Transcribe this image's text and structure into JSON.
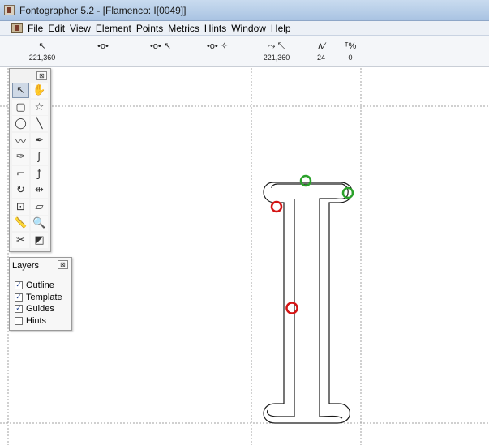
{
  "window": {
    "title": "Fontographer 5.2 - [Flamenco: I[0049]]",
    "app_icon": "fontographer-app-icon"
  },
  "menu": {
    "doc_icon": "document-icon",
    "items": [
      "File",
      "Edit",
      "View",
      "Element",
      "Points",
      "Metrics",
      "Hints",
      "Window",
      "Help"
    ]
  },
  "infobar": {
    "cells": [
      {
        "icon": "arrow-cursor-icon",
        "glyph": "↖",
        "value": "221,360"
      },
      {
        "icon": "curve-point-icon",
        "glyph": "•o•",
        "value": ""
      },
      {
        "icon": "point-arrow-icon",
        "glyph": "•o• ↖",
        "value": ""
      },
      {
        "icon": "point-star-icon",
        "glyph": "•o• ✧",
        "value": ""
      },
      {
        "icon": "move-arrow-icon",
        "glyph": "⤳ ↖",
        "value": "221,360"
      },
      {
        "icon": "angle-icon",
        "glyph": "∧∕",
        "value": "24"
      },
      {
        "icon": "percent-icon",
        "glyph": "ᵀ%",
        "value": "0"
      }
    ]
  },
  "tool_palette": {
    "close_label": "⊠",
    "tools": [
      {
        "name": "pointer-tool-icon",
        "glyph": "↖",
        "selected": true
      },
      {
        "name": "hand-tool-icon",
        "glyph": "✋",
        "selected": false
      },
      {
        "name": "rectangle-tool-icon",
        "glyph": "▢",
        "selected": false
      },
      {
        "name": "star-tool-icon",
        "glyph": "☆",
        "selected": false
      },
      {
        "name": "ellipse-tool-icon",
        "glyph": "◯",
        "selected": false
      },
      {
        "name": "line-tool-icon",
        "glyph": "╲",
        "selected": false
      },
      {
        "name": "freehand-tool-icon",
        "glyph": "〰",
        "selected": false
      },
      {
        "name": "pen-tool-icon",
        "glyph": "✒",
        "selected": false
      },
      {
        "name": "calligraphy-pen-icon",
        "glyph": "✑",
        "selected": false
      },
      {
        "name": "curve-tool-icon",
        "glyph": "ʃ",
        "selected": false
      },
      {
        "name": "corner-point-tool-icon",
        "glyph": "⌐",
        "selected": false
      },
      {
        "name": "tangent-point-tool-icon",
        "glyph": "ƒ",
        "selected": false
      },
      {
        "name": "rotate-tool-icon",
        "glyph": "↻",
        "selected": false
      },
      {
        "name": "reflect-tool-icon",
        "glyph": "⇹",
        "selected": false
      },
      {
        "name": "scale-tool-icon",
        "glyph": "⊡",
        "selected": false
      },
      {
        "name": "skew-tool-icon",
        "glyph": "▱",
        "selected": false
      },
      {
        "name": "measure-tool-icon",
        "glyph": "📏",
        "selected": false
      },
      {
        "name": "zoom-tool-icon",
        "glyph": "🔍",
        "selected": false
      },
      {
        "name": "knife-tool-icon",
        "glyph": "✂",
        "selected": false
      },
      {
        "name": "eraser-tool-icon",
        "glyph": "◩",
        "selected": false
      }
    ]
  },
  "layers": {
    "title": "Layers",
    "close_label": "⊠",
    "items": [
      {
        "label": "Outline",
        "checked": true
      },
      {
        "label": "Template",
        "checked": true
      },
      {
        "label": "Guides",
        "checked": true
      },
      {
        "label": "Hints",
        "checked": false
      }
    ]
  },
  "colors": {
    "guide_line": "#a0a0a0",
    "outline": "#1a1a1a",
    "point_green": "#2aa12a",
    "point_red": "#d41414"
  }
}
